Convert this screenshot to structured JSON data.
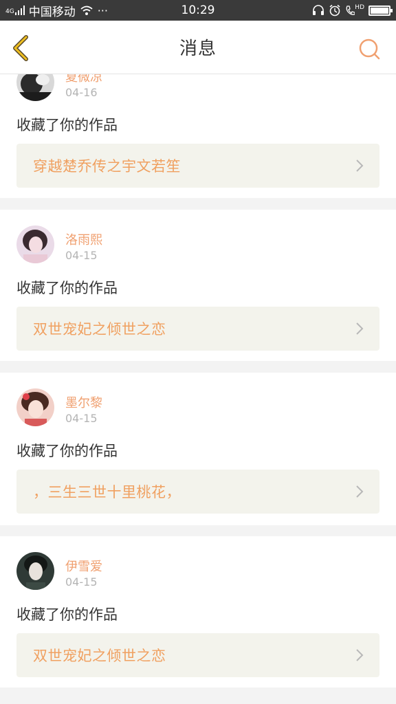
{
  "status_bar": {
    "network": "4G",
    "carrier": "中国移动",
    "more": "···",
    "time": "10:29",
    "hd": "HD"
  },
  "header": {
    "title": "消息"
  },
  "colors": {
    "accent": "#f0a070",
    "back_arrow": "#f0c020",
    "link_bg": "#f3f3ec"
  },
  "messages": [
    {
      "user": "夏微凉",
      "date": "04-16",
      "action": "收藏了你的作品",
      "work_title": "穿越楚乔传之宇文若笙"
    },
    {
      "user": "洛雨熙",
      "date": "04-15",
      "action": "收藏了你的作品",
      "work_title": "双世宠妃之倾世之恋"
    },
    {
      "user": "墨尔黎",
      "date": "04-15",
      "action": "收藏了你的作品",
      "work_title": "，三生三世十里桃花，"
    },
    {
      "user": "伊雪爱",
      "date": "04-15",
      "action": "收藏了你的作品",
      "work_title": "双世宠妃之倾世之恋"
    }
  ]
}
